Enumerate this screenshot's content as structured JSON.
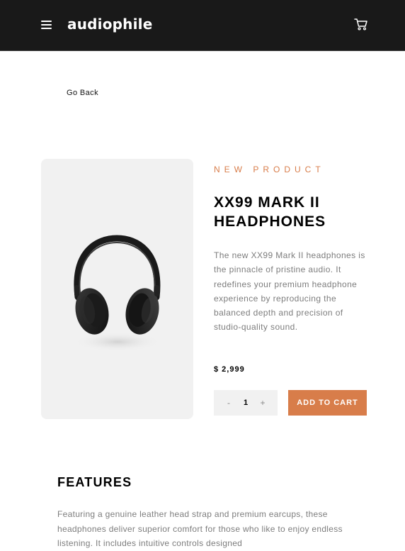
{
  "header": {
    "logo": "audiophile",
    "menu_icon": "hamburger-menu-icon",
    "cart_icon": "shopping-cart-icon"
  },
  "navigation": {
    "go_back_label": "Go Back"
  },
  "product": {
    "overline": "NEW PRODUCT",
    "title": "XX99 MARK II HEADPHONES",
    "description": "The new XX99 Mark II headphones is the pinnacle of pristine audio. It redefines your premium headphone experience by reproducing the balanced depth and precision of studio-quality sound.",
    "price": "$ 2,999",
    "image_alt": "headphones-image",
    "quantity": {
      "decrement_label": "-",
      "value": "1",
      "increment_label": "+"
    },
    "add_to_cart_label": "ADD TO CART"
  },
  "features": {
    "title": "FEATURES",
    "text": "Featuring a genuine leather head strap and premium earcups, these headphones deliver superior comfort for those who like to enjoy endless listening. It includes intuitive controls designed"
  },
  "colors": {
    "header_bg": "#191919",
    "accent": "#d87d4a",
    "image_bg": "#f1f1f1",
    "body_text": "#7d7d7d"
  }
}
